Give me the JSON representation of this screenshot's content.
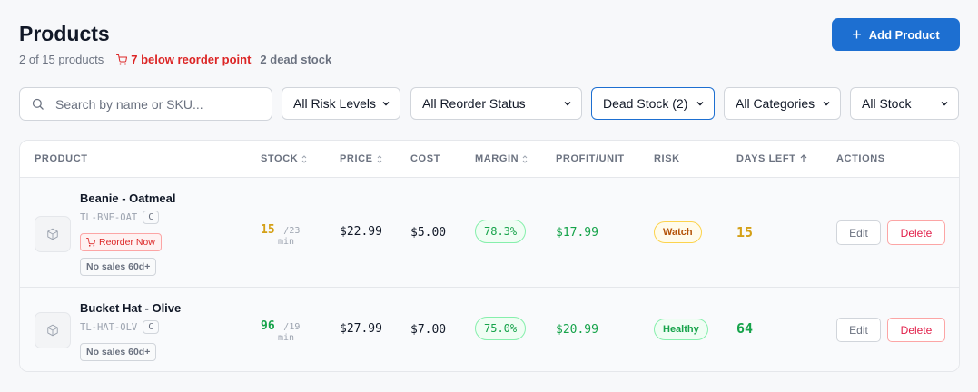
{
  "header": {
    "title": "Products",
    "count_text": "2 of 15 products",
    "reorder_text": "7 below reorder point",
    "dead_text": "2 dead stock",
    "add_label": "Add Product"
  },
  "filters": {
    "search_placeholder": "Search by name or SKU...",
    "risk": "All Risk Levels",
    "reorder": "All Reorder Status",
    "dead": "Dead Stock (2)",
    "categories": "All Categories",
    "stock": "All Stock"
  },
  "table": {
    "columns": {
      "product": "PRODUCT",
      "stock": "STOCK",
      "price": "PRICE",
      "cost": "COST",
      "margin": "MARGIN",
      "profit": "PROFIT/UNIT",
      "risk": "RISK",
      "days": "DAYS LEFT",
      "actions": "ACTIONS"
    },
    "rows": [
      {
        "name": "Beanie - Oatmeal",
        "sku": "TL-BNE-OAT",
        "category": "C",
        "reorder_badge": "Reorder Now",
        "nosales_badge": "No sales 60d+",
        "stock_qty": "15",
        "stock_of": "/23",
        "stock_min": "min",
        "stock_color": "#d4a017",
        "price": "$22.99",
        "cost": "$5.00",
        "margin": "78.3%",
        "profit": "$17.99",
        "risk": "Watch",
        "days": "15",
        "days_color": "#d4a017",
        "edit": "Edit",
        "delete": "Delete"
      },
      {
        "name": "Bucket Hat - Olive",
        "sku": "TL-HAT-OLV",
        "category": "C",
        "nosales_badge": "No sales 60d+",
        "stock_qty": "96",
        "stock_of": "/19",
        "stock_min": "min",
        "stock_color": "#16a34a",
        "price": "$27.99",
        "cost": "$7.00",
        "margin": "75.0%",
        "profit": "$20.99",
        "risk": "Healthy",
        "days": "64",
        "days_color": "#16a34a",
        "edit": "Edit",
        "delete": "Delete"
      }
    ]
  }
}
